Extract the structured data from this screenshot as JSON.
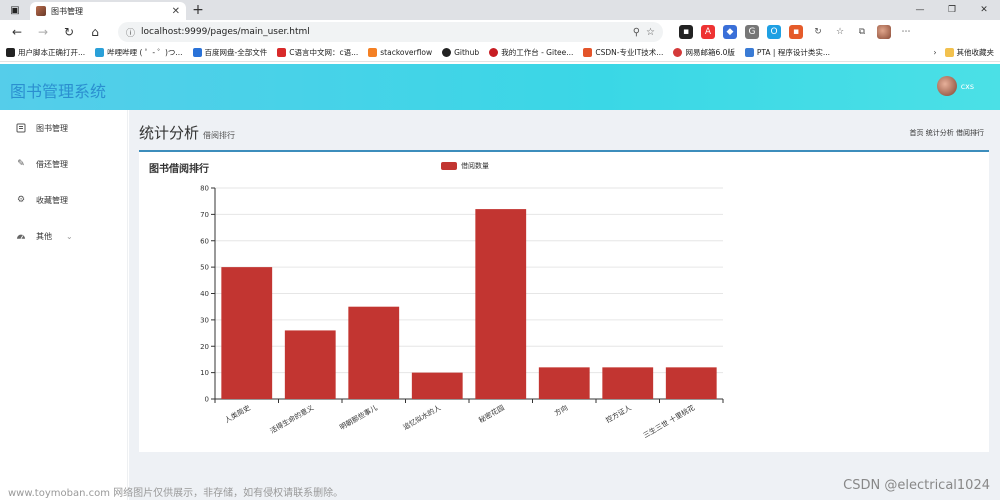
{
  "browser": {
    "tab_title": "图书管理",
    "url": "localhost:9999/pages/main_user.html",
    "bookmarks": [
      {
        "label": "用户脚本正确打开...",
        "color": "#222"
      },
      {
        "label": "哔哩哔哩 ( ゜- ゜)つ...",
        "color": "#2aa0d8"
      },
      {
        "label": "百度网盘-全部文件",
        "color": "#2a72d8"
      },
      {
        "label": "C语言中文网：c语...",
        "color": "#d82a2a"
      },
      {
        "label": "stackoverflow",
        "color": "#f48024"
      },
      {
        "label": "Github",
        "color": "#222"
      },
      {
        "label": "我的工作台 - Gitee...",
        "color": "#c71d23"
      },
      {
        "label": "CSDN-专业IT技术...",
        "color": "#e3542a"
      },
      {
        "label": "网易邮箱6.0版",
        "color": "#d43a3a"
      },
      {
        "label": "PTA | 程序设计类实...",
        "color": "#3a7bd5"
      }
    ],
    "other_bookmarks": "其他收藏夹"
  },
  "app": {
    "title": "图书管理系统",
    "username": "cxs"
  },
  "sidebar": {
    "items": [
      {
        "label": "图书管理",
        "icon": "book-icon"
      },
      {
        "label": "借还管理",
        "icon": "pencil-icon"
      },
      {
        "label": "收藏管理",
        "icon": "gear-icon"
      },
      {
        "label": "其他",
        "icon": "dashboard-icon"
      }
    ]
  },
  "page": {
    "title": "统计分析",
    "subtitle": "借阅排行",
    "breadcrumb": "首页 统计分析 借阅排行"
  },
  "chart_data": {
    "type": "bar",
    "title": "图书借阅排行",
    "categories": [
      "人类简史",
      "活得生命的意义",
      "明朝那些事儿",
      "追忆似水的人",
      "秘密花园",
      "方向",
      "控方证人",
      "三生三世 十里桃花"
    ],
    "series": [
      {
        "name": "借阅数量",
        "values": [
          50,
          26,
          35,
          10,
          72,
          12,
          12,
          12
        ],
        "color": "#c23531"
      }
    ],
    "ylim": [
      0,
      80
    ],
    "yticks": [
      0,
      10,
      20,
      30,
      40,
      50,
      60,
      70,
      80
    ],
    "grid": true,
    "legend": "top-center"
  },
  "watermarks": {
    "left": "www.toymoban.com 网络图片仅供展示，非存储，如有侵权请联系删除。",
    "right": "CSDN @electrical1024"
  }
}
